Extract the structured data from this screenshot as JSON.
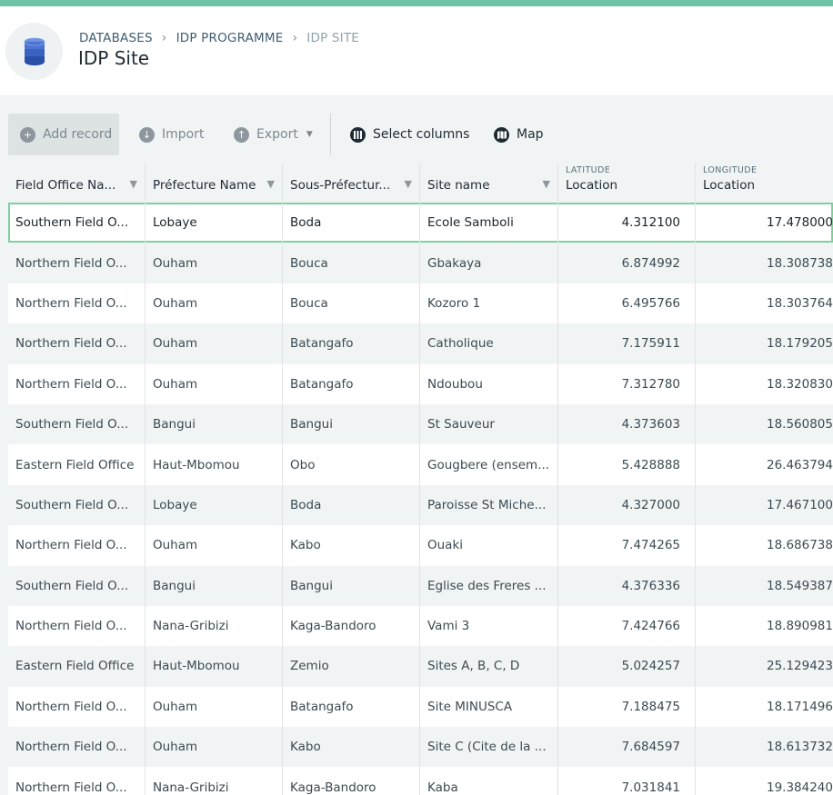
{
  "breadcrumb": {
    "items": [
      "DATABASES",
      "IDP PROGRAMME",
      "IDP SITE"
    ]
  },
  "page": {
    "title": "IDP Site"
  },
  "toolbar": {
    "add_record": "Add record",
    "import": "Import",
    "export": "Export",
    "select_columns": "Select columns",
    "map": "Map"
  },
  "columns": [
    {
      "sub": "",
      "label": "Field Office Na..."
    },
    {
      "sub": "",
      "label": "Préfecture Name"
    },
    {
      "sub": "",
      "label": "Sous-Préfectur..."
    },
    {
      "sub": "",
      "label": "Site name"
    },
    {
      "sub": "LATITUDE",
      "label": "Location"
    },
    {
      "sub": "LONGITUDE",
      "label": "Location"
    }
  ],
  "rows": [
    [
      "Southern Field O...",
      "Lobaye",
      "Boda",
      "Ecole Samboli",
      "4.312100",
      "17.478000"
    ],
    [
      "Northern Field O...",
      "Ouham",
      "Bouca",
      "Gbakaya",
      "6.874992",
      "18.308738"
    ],
    [
      "Northern Field O...",
      "Ouham",
      "Bouca",
      "Kozoro 1",
      "6.495766",
      "18.303764"
    ],
    [
      "Northern Field O...",
      "Ouham",
      "Batangafo",
      "Catholique",
      "7.175911",
      "18.179205"
    ],
    [
      "Northern Field O...",
      "Ouham",
      "Batangafo",
      "Ndoubou",
      "7.312780",
      "18.320830"
    ],
    [
      "Southern Field O...",
      "Bangui",
      "Bangui",
      "St Sauveur",
      "4.373603",
      "18.560805"
    ],
    [
      "Eastern Field Office",
      "Haut-Mbomou",
      "Obo",
      "Gougbere (ensem...",
      "5.428888",
      "26.463794"
    ],
    [
      "Southern Field O...",
      "Lobaye",
      "Boda",
      "Paroisse St Miche...",
      "4.327000",
      "17.467100"
    ],
    [
      "Northern Field O...",
      "Ouham",
      "Kabo",
      "Ouaki",
      "7.474265",
      "18.686738"
    ],
    [
      "Southern Field O...",
      "Bangui",
      "Bangui",
      "Eglise des Freres ...",
      "4.376336",
      "18.549387"
    ],
    [
      "Northern Field O...",
      "Nana-Gribizi",
      "Kaga-Bandoro",
      "Vami 3",
      "7.424766",
      "18.890981"
    ],
    [
      "Eastern Field Office",
      "Haut-Mbomou",
      "Zemio",
      "Sites A, B, C, D",
      "5.024257",
      "25.129423"
    ],
    [
      "Northern Field O...",
      "Ouham",
      "Batangafo",
      "Site MINUSCA",
      "7.188475",
      "18.171496"
    ],
    [
      "Northern Field O...",
      "Ouham",
      "Kabo",
      "Site C (Cite de la ...",
      "7.684597",
      "18.613732"
    ],
    [
      "Northern Field O...",
      "Nana-Gribizi",
      "Kaga-Bandoro",
      "Kaba",
      "7.031841",
      "19.384240"
    ]
  ],
  "icons": {
    "database": "database-icon",
    "add": "plus-circle-icon",
    "import": "import-icon",
    "export": "export-icon",
    "select_columns": "columns-icon",
    "map": "map-icon",
    "filter": "filter-icon"
  },
  "colors": {
    "accent": "#6cc3a6",
    "selection": "#7fd19c",
    "database_blue": "#2f55b8"
  }
}
